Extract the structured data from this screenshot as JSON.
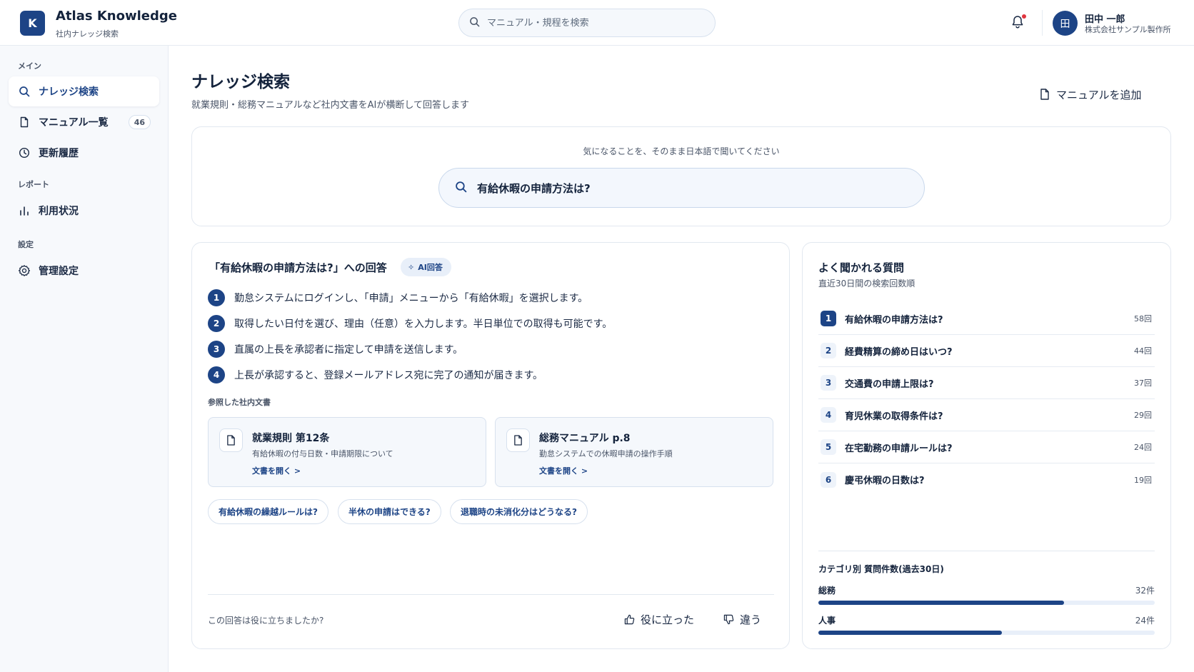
{
  "app": {
    "logo_letter": "K",
    "title": "Atlas Knowledge",
    "subtitle": "社内ナレッジ検索"
  },
  "header": {
    "search_placeholder": "マニュアル・規程を検索",
    "user": {
      "avatar_letter": "田",
      "name": "田中 一郎",
      "org": "株式会社サンプル製作所"
    }
  },
  "sidebar": {
    "sections": [
      {
        "label": "メイン",
        "items": [
          {
            "label": "ナレッジ検索",
            "icon": "search-icon",
            "active": true
          },
          {
            "label": "マニュアル一覧",
            "icon": "document-icon",
            "badge": "46"
          },
          {
            "label": "更新履歴",
            "icon": "clock-icon"
          }
        ]
      },
      {
        "label": "レポート",
        "items": [
          {
            "label": "利用状況",
            "icon": "bar-chart-icon"
          }
        ]
      },
      {
        "label": "設定",
        "items": [
          {
            "label": "管理設定",
            "icon": "gear-icon"
          }
        ]
      }
    ]
  },
  "page": {
    "title": "ナレッジ検索",
    "description": "就業規則・総務マニュアルなど社内文書をAIが横断して回答します",
    "add_button": "マニュアルを追加"
  },
  "ask": {
    "prompt": "気になることを、そのまま日本語で聞いてください",
    "query": "有給休暇の申請方法は?"
  },
  "answer": {
    "title": "「有給休暇の申請方法は?」への回答",
    "badge": "AI回答",
    "steps": [
      {
        "num": "1",
        "text": "勤怠システムにログインし、「申請」メニューから「有給休暇」を選択します。"
      },
      {
        "num": "2",
        "text": "取得したい日付を選び、理由（任意）を入力します。半日単位での取得も可能です。"
      },
      {
        "num": "3",
        "text": "直属の上長を承認者に指定して申請を送信します。"
      },
      {
        "num": "4",
        "text": "上長が承認すると、登録メールアドレス宛に完了の通知が届きます。"
      }
    ],
    "references_label": "参照した社内文書",
    "references": [
      {
        "title": "就業規則 第12条",
        "desc": "有給休暇の付与日数・申請期限について",
        "link": "文書を開く >"
      },
      {
        "title": "総務マニュアル p.8",
        "desc": "勤怠システムでの休暇申請の操作手順",
        "link": "文書を開く >"
      }
    ],
    "related": [
      "有給休暇の繰越ルールは?",
      "半休の申請はできる?",
      "退職時の未消化分はどうなる?"
    ],
    "feedback_question": "この回答は役に立ちましたか?",
    "feedback_yes": "役に立った",
    "feedback_no": "違う"
  },
  "faq": {
    "title": "よく聞かれる質問",
    "subtitle": "直近30日間の検索回数順",
    "items": [
      {
        "rank": "1",
        "question": "有給休暇の申請方法は?",
        "count": "58回"
      },
      {
        "rank": "2",
        "question": "経費精算の締め日はいつ?",
        "count": "44回"
      },
      {
        "rank": "3",
        "question": "交通費の申請上限は?",
        "count": "37回"
      },
      {
        "rank": "4",
        "question": "育児休業の取得条件は?",
        "count": "29回"
      },
      {
        "rank": "5",
        "question": "在宅勤務の申請ルールは?",
        "count": "24回"
      },
      {
        "rank": "6",
        "question": "慶弔休暇の日数は?",
        "count": "19回"
      }
    ],
    "categories_title": "カテゴリ別 質問件数(過去30日)",
    "categories": [
      {
        "label": "総務",
        "count": "32件",
        "fraction": 0.73
      },
      {
        "label": "人事",
        "count": "24件",
        "fraction": 0.545
      }
    ]
  },
  "colors": {
    "accent": "#1d4486",
    "notification": "#e0353f",
    "background_sidebar": "#f7f9fc"
  }
}
